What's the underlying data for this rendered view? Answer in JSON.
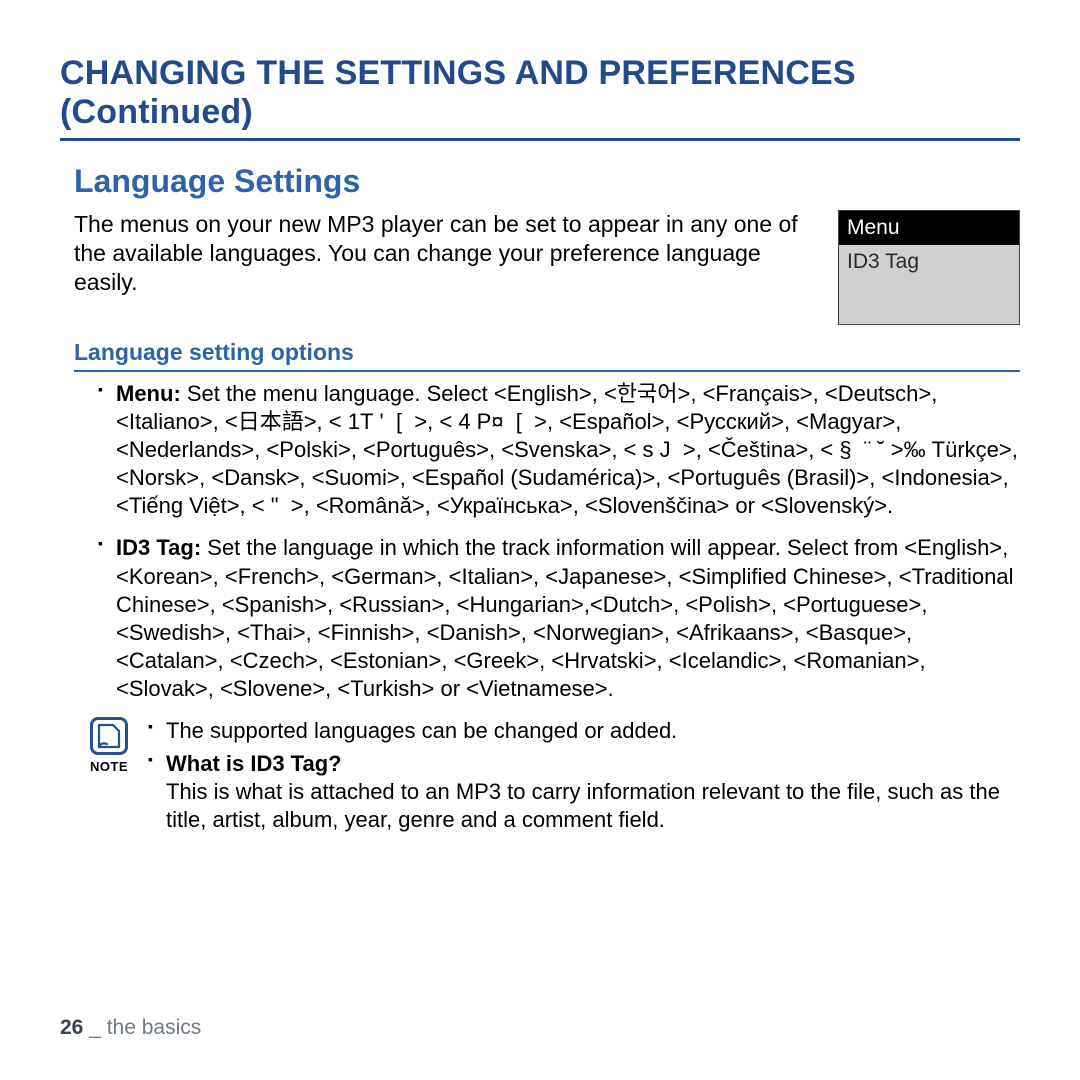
{
  "title": "CHANGING THE SETTINGS AND PREFERENCES (Continued)",
  "section": "Language Settings",
  "intro": "The menus on your new MP3 player can be set to appear in any one of the available languages. You can change your preference language easily.",
  "menu_box": {
    "header": "Menu",
    "row1": "ID3 Tag"
  },
  "options_heading": "Language setting options",
  "menu_item": {
    "label": "Menu:",
    "text": " Set the menu language. Select <English>, <한국어>, <Français>, <Deutsch>, <Italiano>, <日本語>, < 1T '  [  >, < 4 P¤  [  >, <Español>, <Pусский>, <Magyar>, <Nederlands>, <Polski>, <Português>, <Svenska>, < s J  >, <Čeština>, < §  ¨ ˘ >‰ Türkçe>, <Norsk>, <Dansk>, <Suomi>, <Español (Sudamérica)>, <Português (Brasil)>, <Indonesia>, <Tiếng Việt>, < \"  >, <Română>, <Українська>, <Slovenščina> or <Slovenský>."
  },
  "id3_item": {
    "label": "ID3 Tag:",
    "text": " Set the language in which the track information will appear. Select from <English>, <Korean>, <French>, <German>, <Italian>, <Japanese>, <Simplified Chinese>, <Traditional Chinese>, <Spanish>, <Russian>, <Hungarian>,<Dutch>, <Polish>, <Portuguese>, <Swedish>, <Thai>, <Finnish>, <Danish>, <Norwegian>, <Afrikaans>,  <Basque>, <Catalan>, <Czech>, <Estonian>, <Greek>, <Hrvatski>, <Icelandic>, <Romanian>, <Slovak>, <Slovene>, <Turkish> or <Vietnamese>."
  },
  "note": {
    "label": "NOTE",
    "line1": "The supported languages can be changed or added.",
    "q": "What is ID3 Tag?",
    "a": "This is what is attached to an MP3 to carry information relevant to the file, such as the title, artist, album, year, genre and a comment field."
  },
  "footer": {
    "page": "26",
    "sep": " _ ",
    "section": "the basics"
  }
}
